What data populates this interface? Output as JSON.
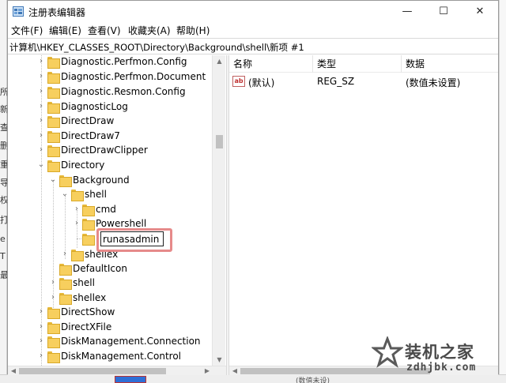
{
  "window": {
    "title": "注册表编辑器",
    "controls": {
      "minimize": "—",
      "maximize": "☐",
      "close": "✕"
    }
  },
  "menu": [
    "文件(F)",
    "编辑(E)",
    "查看(V)",
    "收藏夹(A)",
    "帮助(H)"
  ],
  "address": "计算机\\HKEY_CLASSES_ROOT\\Directory\\Background\\shell\\新项 #1",
  "tree": {
    "items": [
      {
        "label": "Diagnostic.Perfmon.Config"
      },
      {
        "label": "Diagnostic.Perfmon.Document"
      },
      {
        "label": "Diagnostic.Resmon.Config"
      },
      {
        "label": "DiagnosticLog"
      },
      {
        "label": "DirectDraw"
      },
      {
        "label": "DirectDraw7"
      },
      {
        "label": "DirectDrawClipper"
      },
      {
        "label": "Directory"
      },
      {
        "label": "Background"
      },
      {
        "label": "shell"
      },
      {
        "label": "cmd"
      },
      {
        "label": "Powershell"
      },
      {
        "label": "shellex"
      },
      {
        "label": "DefaultIcon"
      },
      {
        "label": "shell"
      },
      {
        "label": "shellex"
      },
      {
        "label": "DirectShow"
      },
      {
        "label": "DirectXFile"
      },
      {
        "label": "DiskManagement.Connection"
      },
      {
        "label": "DiskManagement.Control"
      }
    ],
    "rename_value": "runasadmin"
  },
  "list": {
    "headers": {
      "name": "名称",
      "type": "类型",
      "data": "数据"
    },
    "rows": [
      {
        "icon": "ab",
        "name": "(默认)",
        "type": "REG_SZ",
        "data": "(数值未设置)"
      }
    ]
  },
  "background_text": {
    "left_chars": [
      "所",
      "新",
      "查",
      "删",
      "重",
      "导",
      "权",
      "打",
      "e",
      "T",
      "最"
    ],
    "bottom_text": "(数值未设)"
  },
  "watermark": {
    "brand": "装机之家",
    "url": "zdhjbk.com"
  },
  "colors": {
    "folder": "#f7cf5e",
    "highlight_box": "#e68a8a",
    "watermark": "#4a4a4a"
  }
}
